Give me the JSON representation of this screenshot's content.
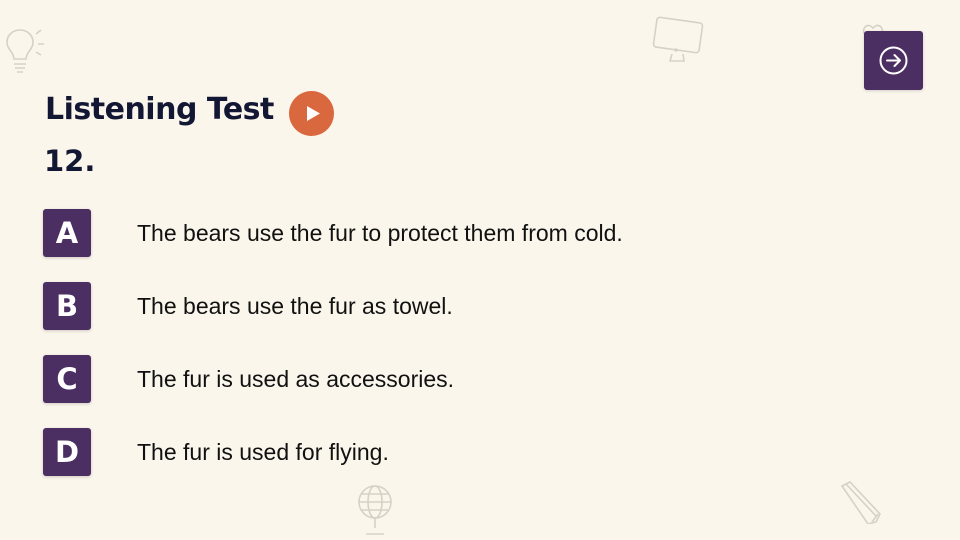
{
  "header": {
    "title": "Listening Test",
    "question_number": "12."
  },
  "controls": {
    "play_icon": "play-icon",
    "next_icon": "arrow-right-circle-icon"
  },
  "options": [
    {
      "letter": "A",
      "text": "The bears use the fur to protect them from cold."
    },
    {
      "letter": "B",
      "text": "The bears use the fur as towel."
    },
    {
      "letter": "C",
      "text": "The fur is used as accessories."
    },
    {
      "letter": "D",
      "text": "The fur is used for flying."
    }
  ],
  "colors": {
    "background": "#fbf6ec",
    "primary": "#4b2f63",
    "accent": "#d9683e",
    "text": "#121733"
  },
  "decorations": [
    "lightbulb-icon",
    "monitor-icon",
    "heart-icon",
    "globe-icon",
    "pencil-icon"
  ]
}
